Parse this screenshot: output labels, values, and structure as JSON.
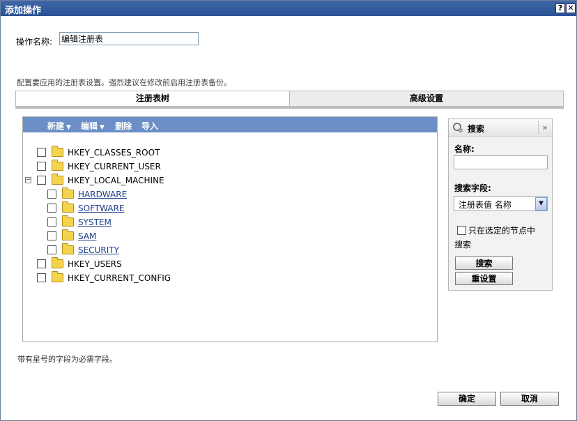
{
  "window": {
    "title": "添加操作",
    "help_label": "?",
    "close_label": "✕"
  },
  "form": {
    "name_label": "操作名称:",
    "name_value": "编辑注册表"
  },
  "description": "配置要应用的注册表设置。强烈建议在修改前启用注册表备份。",
  "tabs": [
    {
      "label": "注册表树",
      "active": true
    },
    {
      "label": "高级设置",
      "active": false
    }
  ],
  "toolbar": {
    "new_label": "新建",
    "edit_label": "编辑",
    "delete_label": "删除",
    "import_label": "导入"
  },
  "tree": {
    "root_nodes": [
      {
        "label": "HKEY_CLASSES_ROOT"
      },
      {
        "label": "HKEY_CURRENT_USER"
      },
      {
        "label": "HKEY_LOCAL_MACHINE",
        "expanded": true,
        "children": [
          {
            "label": "HARDWARE"
          },
          {
            "label": "SOFTWARE"
          },
          {
            "label": "SYSTEM"
          },
          {
            "label": "SAM"
          },
          {
            "label": "SECURITY"
          }
        ]
      },
      {
        "label": "HKEY_USERS"
      },
      {
        "label": "HKEY_CURRENT_CONFIG"
      }
    ]
  },
  "search": {
    "title": "搜索",
    "collapse_glyph": "»",
    "name_label": "名称:",
    "field_label": "搜索字段:",
    "field_value": "注册表值 名称",
    "only_selected_label": "只在选定的节点中",
    "only_selected_label2": "搜索",
    "search_button": "搜索",
    "reset_button": "重设置"
  },
  "required_note": "带有星号的字段为必需字段。",
  "footer": {
    "ok_label": "确定",
    "cancel_label": "取消"
  },
  "colors": {
    "titlebar": "#2f5a9c",
    "toolbar": "#6b8ec6",
    "link": "#1b3e8a"
  }
}
